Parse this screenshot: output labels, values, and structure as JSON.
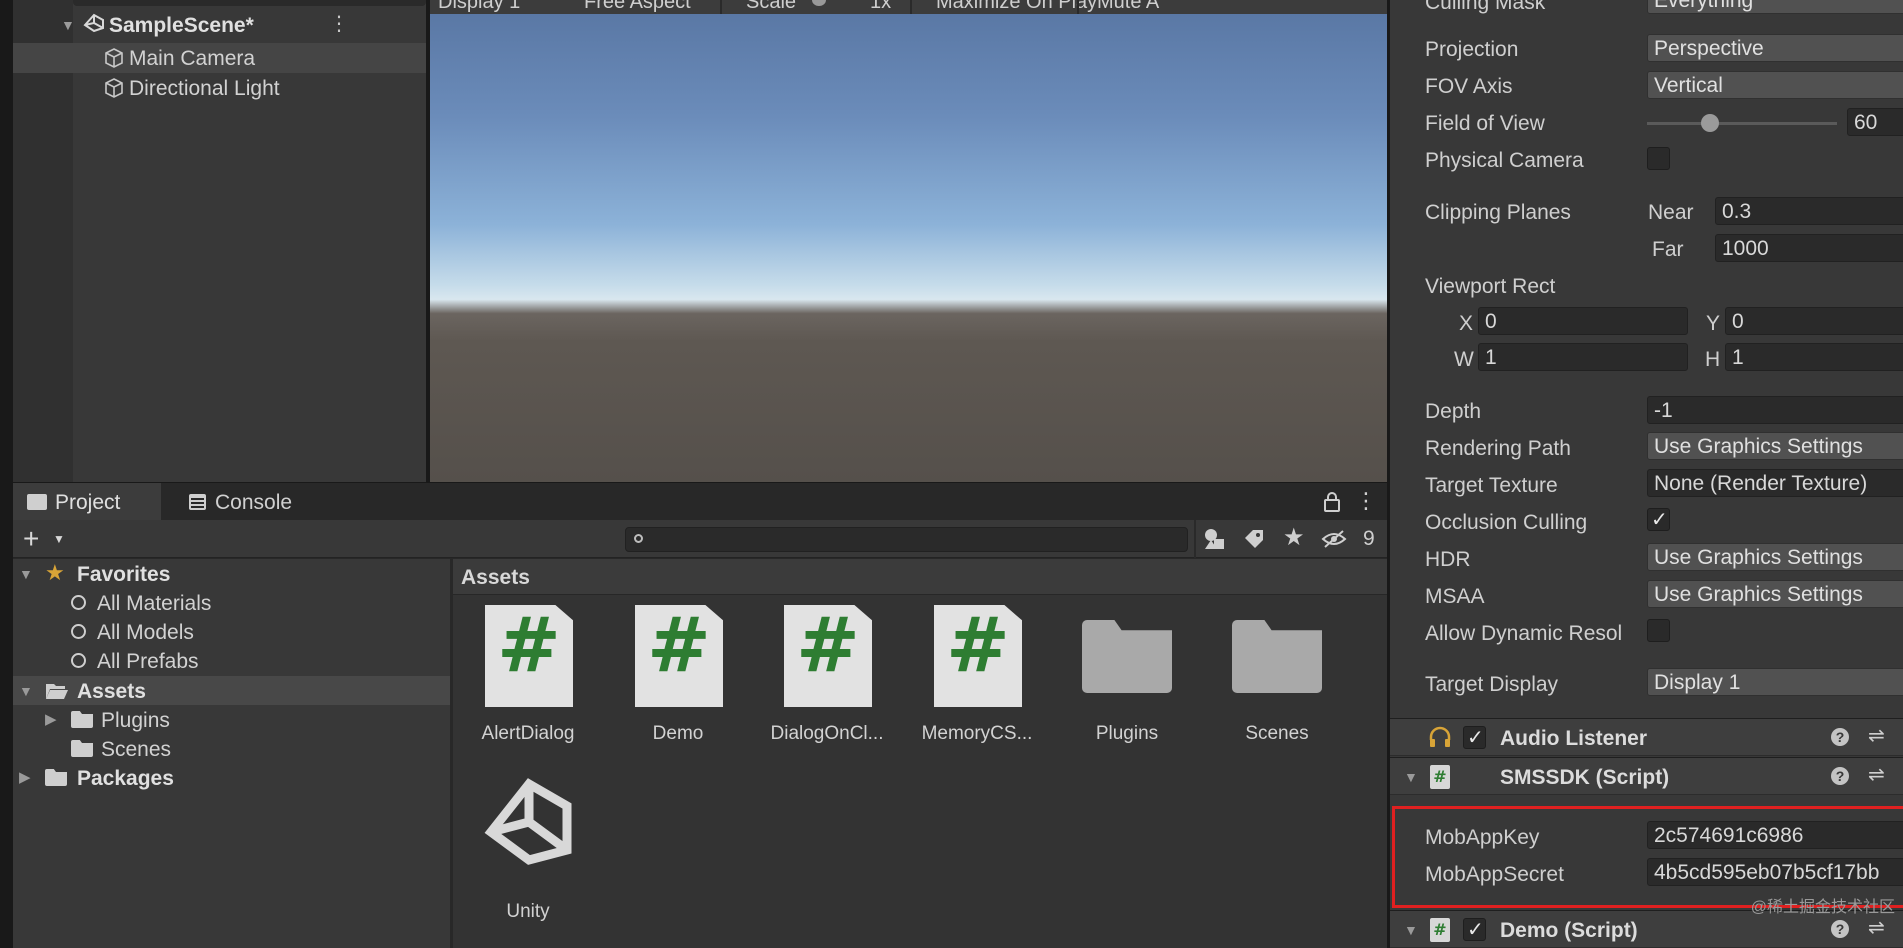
{
  "hierarchy": {
    "scene_name": "SampleScene*",
    "items": [
      {
        "label": "Main Camera",
        "icon": "cube-icon"
      },
      {
        "label": "Directional Light",
        "icon": "cube-icon"
      }
    ]
  },
  "game_view": {
    "toolbar": [
      "Display 1",
      "Free Aspect",
      "Scale",
      "1x",
      "Maximize On Play",
      "Mute A"
    ]
  },
  "project_panel": {
    "tabs": [
      {
        "label": "Project",
        "icon": "folder-icon"
      },
      {
        "label": "Console",
        "icon": "console-icon"
      }
    ],
    "hidden_count": "9",
    "favorites": {
      "label": "Favorites",
      "items": [
        "All Materials",
        "All Models",
        "All Prefabs"
      ]
    },
    "tree": {
      "assets_label": "Assets",
      "asset_children": [
        "Plugins",
        "Scenes"
      ],
      "packages_label": "Packages"
    },
    "grid_title": "Assets",
    "assets": [
      {
        "label": "AlertDialog",
        "kind": "script"
      },
      {
        "label": "Demo",
        "kind": "script"
      },
      {
        "label": "DialogOnCl...",
        "kind": "script"
      },
      {
        "label": "MemoryCS...",
        "kind": "script"
      },
      {
        "label": "Plugins",
        "kind": "folder"
      },
      {
        "label": "Scenes",
        "kind": "folder"
      },
      {
        "label": "Unity",
        "kind": "unity-scene"
      }
    ]
  },
  "inspector": {
    "culling_mask": {
      "label": "Culling Mask",
      "value": "Everything"
    },
    "projection": {
      "label": "Projection",
      "value": "Perspective"
    },
    "fov_axis": {
      "label": "FOV Axis",
      "value": "Vertical"
    },
    "field_of_view": {
      "label": "Field of View",
      "value": "60",
      "slider_fraction": 0.33
    },
    "physical_camera": {
      "label": "Physical Camera"
    },
    "clipping_planes": {
      "label": "Clipping Planes",
      "near_label": "Near",
      "near": "0.3",
      "far_label": "Far",
      "far": "1000"
    },
    "viewport_rect": {
      "label": "Viewport Rect",
      "x_label": "X",
      "x": "0",
      "y_label": "Y",
      "y": "0",
      "w_label": "W",
      "w": "1",
      "h_label": "H",
      "h": "1"
    },
    "depth": {
      "label": "Depth",
      "value": "-1"
    },
    "rendering_path": {
      "label": "Rendering Path",
      "value": "Use Graphics Settings"
    },
    "target_texture": {
      "label": "Target Texture",
      "value": "None (Render Texture)"
    },
    "occlusion_culling": {
      "label": "Occlusion Culling"
    },
    "hdr": {
      "label": "HDR",
      "value": "Use Graphics Settings"
    },
    "msaa": {
      "label": "MSAA",
      "value": "Use Graphics Settings"
    },
    "allow_dynamic": {
      "label": "Allow Dynamic Resol"
    },
    "target_display": {
      "label": "Target Display",
      "value": "Display 1"
    },
    "audio_listener": {
      "title": "Audio Listener"
    },
    "smssdk": {
      "title": "SMSSDK (Script)",
      "app_key_label": "MobAppKey",
      "app_key": "2c574691c6986",
      "app_secret_label": "MobAppSecret",
      "app_secret": "4b5cd595eb07b5cf17bb"
    },
    "demo_script": {
      "title": "Demo (Script)"
    }
  },
  "watermark": "@稀土掘金技术社区",
  "colors": {
    "highlight": "#e02020",
    "script_hash": "#2e7d32",
    "panel": "#383838"
  }
}
